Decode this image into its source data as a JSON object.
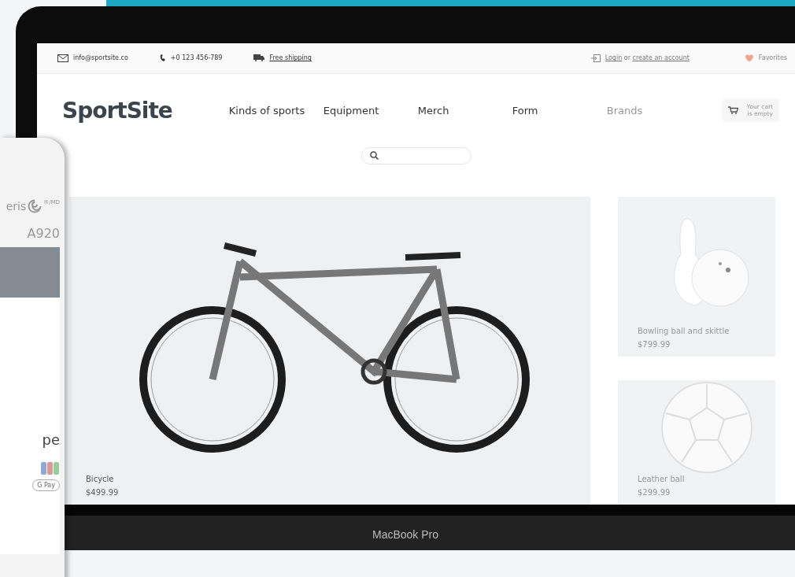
{
  "topbar": {
    "email": "info@sportsite.co",
    "phone": "+0 123 456-789",
    "shipping": "Free shipping",
    "login": "Login",
    "or": "or",
    "create_account": "create an account",
    "favorites": "Favorites"
  },
  "header": {
    "logo": "SportSite",
    "nav": [
      "Kinds of sports",
      "Equipment",
      "Merch",
      "Form",
      "Brands"
    ],
    "cart": "Your cart is empty"
  },
  "products": [
    {
      "kind": "bicycle",
      "name": "Bicycle",
      "price": "$499.99"
    },
    {
      "kind": "bowling",
      "name": "Bowling ball and skittle",
      "price": "$799.99"
    },
    {
      "kind": "ball",
      "name": "Leather ball",
      "price": "$299.99"
    }
  ],
  "laptop": {
    "label": "MacBook Pro"
  },
  "terminal": {
    "brand": "eris",
    "mark": "®/MD",
    "model": "A920",
    "screen_text": "pe",
    "wallet": "G Pay"
  }
}
